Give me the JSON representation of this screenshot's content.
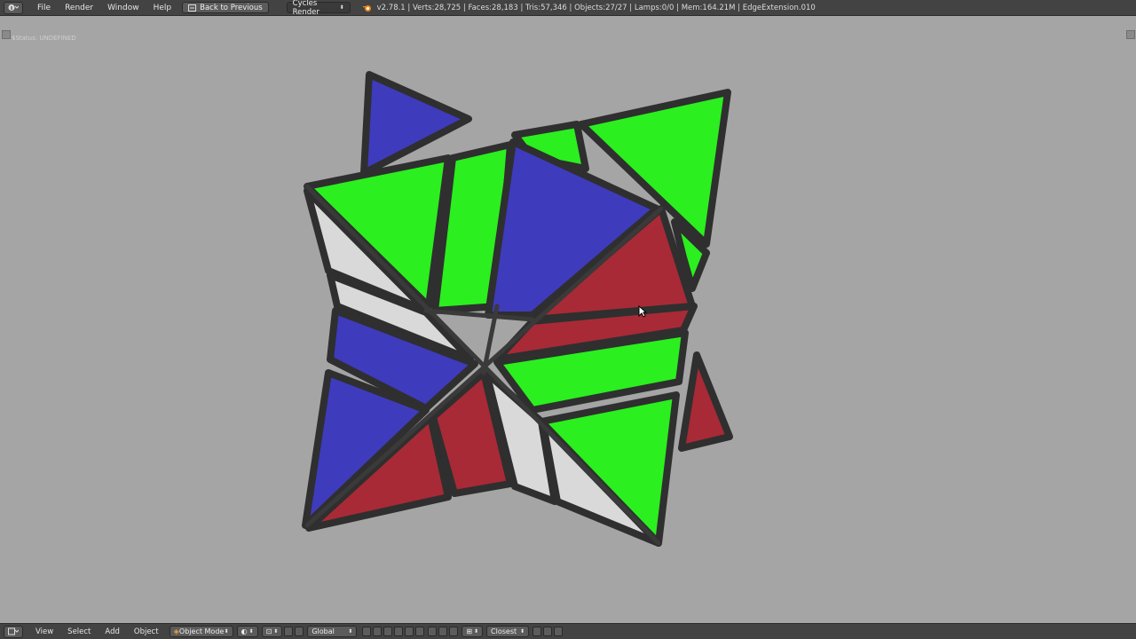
{
  "topbar": {
    "menus": [
      "File",
      "Render",
      "Window",
      "Help"
    ],
    "back_label": "Back to Previous",
    "engine_label": "Cycles Render",
    "stats": "v2.78.1 | Verts:28,725 | Faces:28,183 | Tris:57,346 | Objects:27/27 | Lamps:0/0 | Mem:164.21M | EdgeExtension.010"
  },
  "viewport": {
    "status_text": "$Status: UNDEFINED"
  },
  "bottombar": {
    "menus": [
      "View",
      "Select",
      "Add",
      "Object"
    ],
    "mode_label": "Object Mode",
    "orientation_label": "Global",
    "snap_label": "Closest"
  },
  "colors": {
    "background": "#a5a5a5",
    "header": "#434343",
    "green": "#2bef1f",
    "blue": "#3f3bbd",
    "red": "#a82a36",
    "white": "#d9d9d9",
    "frame": "#2f2f2f"
  }
}
